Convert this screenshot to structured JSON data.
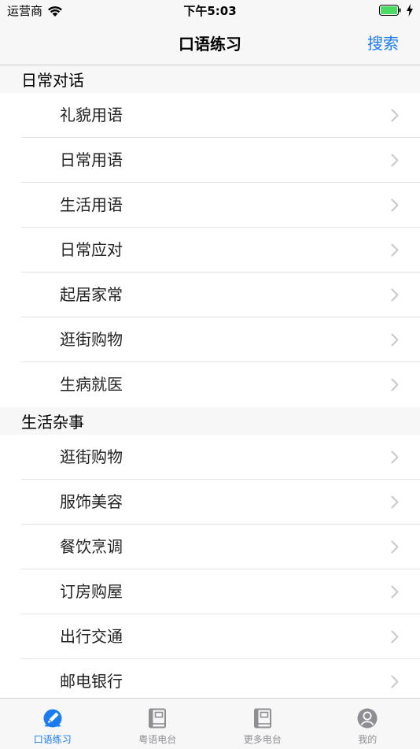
{
  "status_bar": {
    "carrier": "运营商",
    "time": "下午5:03"
  },
  "nav": {
    "title": "口语练习",
    "search_label": "搜索"
  },
  "sections": [
    {
      "title": "日常对话",
      "items": [
        "礼貌用语",
        "日常用语",
        "生活用语",
        "日常应对",
        "起居家常",
        "逛街购物",
        "生病就医"
      ]
    },
    {
      "title": "生活杂事",
      "items": [
        "逛街购物",
        "服饰美容",
        "餐饮烹调",
        "订房购屋",
        "出行交通",
        "邮电银行"
      ]
    }
  ],
  "tabs": [
    {
      "label": "口语练习",
      "icon": "pencil-icon",
      "active": true
    },
    {
      "label": "粤语电台",
      "icon": "book-icon",
      "active": false
    },
    {
      "label": "更多电台",
      "icon": "book-icon",
      "active": false
    },
    {
      "label": "我的",
      "icon": "user-icon",
      "active": false
    }
  ],
  "colors": {
    "accent": "#1a7cf0",
    "inactive": "#8e8e93",
    "battery": "#4cd964"
  }
}
